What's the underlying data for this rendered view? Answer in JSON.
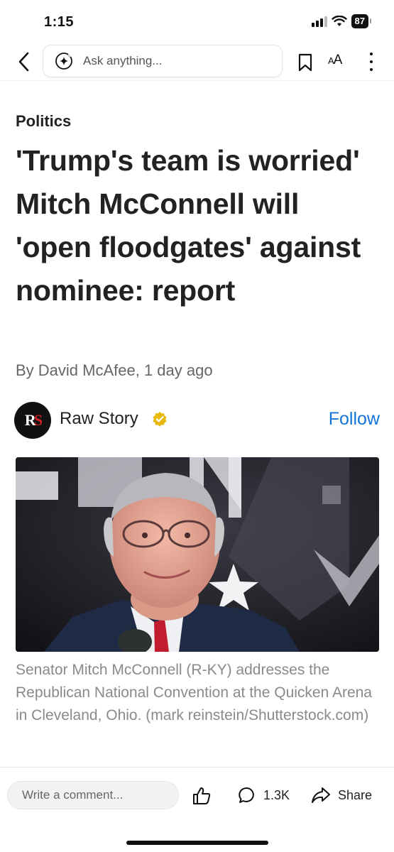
{
  "status_bar": {
    "time": "1:15",
    "battery": "87"
  },
  "top_bar": {
    "ask_placeholder": "Ask anything...",
    "font_label_big": "A",
    "font_label_small": "A"
  },
  "article": {
    "category": "Politics",
    "headline": "'Trump's team is worried' Mitch McConnell will 'open floodgates' against nominee: report",
    "byline": "By David McAfee, 1 day ago",
    "source": {
      "name": "Raw Story",
      "logo_text_1": "R",
      "logo_text_2": "S",
      "follow_label": "Follow"
    },
    "photo": {
      "caption": "Senator Mitch McConnell (R-KY) addresses the Republican National Convention at the Quicken Arena in Cleveland, Ohio. (mark reinstein/Shutterstock.com)"
    }
  },
  "bottom_bar": {
    "comment_placeholder": "Write a comment...",
    "comment_count": "1.3K",
    "share_label": "Share"
  },
  "colors": {
    "accent": "#1474d8",
    "verified": "#e8b90f",
    "logo_red": "#d51f27"
  },
  "icons": [
    "back-chevron-icon",
    "sparkle-icon",
    "bookmark-icon",
    "font-size-icon",
    "more-vertical-icon",
    "verified-badge-icon",
    "thumbs-up-icon",
    "comment-bubble-icon",
    "share-arrow-icon"
  ]
}
